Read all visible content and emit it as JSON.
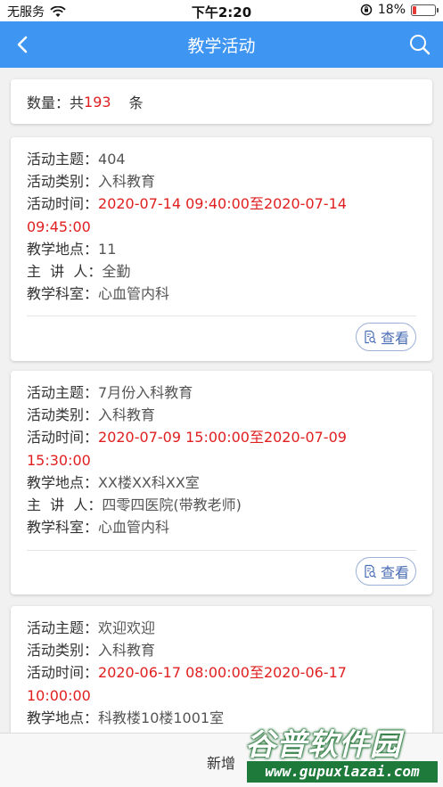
{
  "status_bar": {
    "carrier": "无服务",
    "time": "下午2:20",
    "battery_percent": "18%",
    "battery_level": 0.18
  },
  "nav": {
    "title": "教学活动"
  },
  "summary": {
    "label": "数量：共",
    "count": "193",
    "unit": "条"
  },
  "field_labels": {
    "theme": "活动主题：",
    "category": "活动类别：",
    "time": "活动时间：",
    "location": "教学地点：",
    "speaker": "主  讲  人：",
    "department": "教学科室："
  },
  "activities": [
    {
      "theme": "404",
      "category": "入科教育",
      "time_line1": "2020-07-14 09:40:00至2020-07-14",
      "time_line2": "09:45:00",
      "location": "11",
      "speaker": "全勤",
      "department": "心血管内科",
      "view_label": "查看"
    },
    {
      "theme": "7月份入科教育",
      "category": "入科教育",
      "time_line1": "2020-07-09 15:00:00至2020-07-09",
      "time_line2": "15:30:00",
      "location": "XX楼XX科XX室",
      "speaker": "四零四医院(带教老师)",
      "department": "心血管内科",
      "view_label": "查看"
    },
    {
      "theme": "欢迎欢迎",
      "category": "入科教育",
      "time_line1": "2020-06-17 08:00:00至2020-06-17",
      "time_line2": "10:00:00",
      "location": "科教楼10楼1001室"
    }
  ],
  "bottom_bar": {
    "add_label": "新增"
  },
  "watermark": {
    "title": "谷普软件园",
    "url": "www.gupuxlazai.com"
  },
  "colors": {
    "nav_blue": "#3f95f2",
    "highlight_red": "#e02020",
    "view_button": "#4a6cb3"
  }
}
